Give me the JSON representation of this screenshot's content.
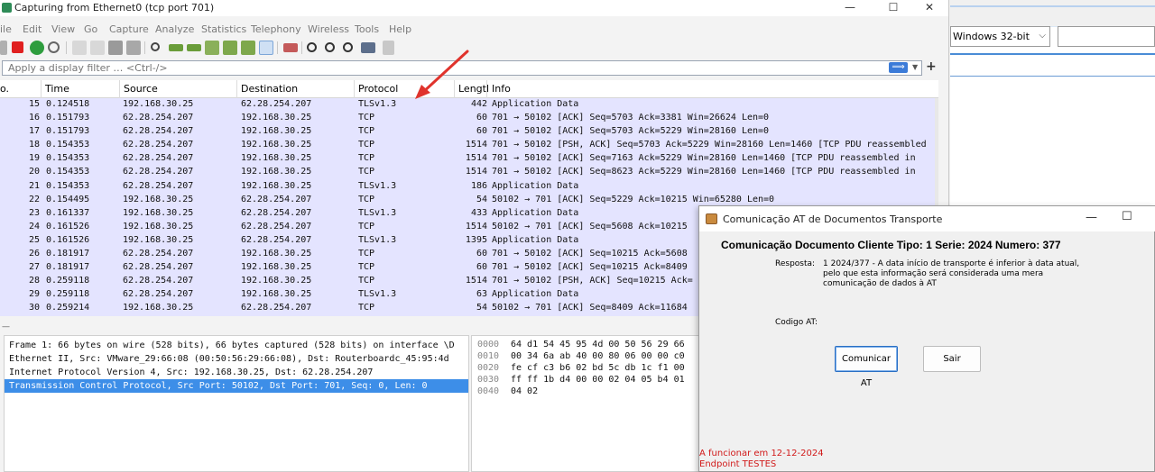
{
  "wireshark": {
    "title": "Capturing from Ethernet0 (tcp port 701)",
    "menu": [
      "ile",
      "Edit",
      "View",
      "Go",
      "Capture",
      "Analyze",
      "Statistics",
      "Telephony",
      "Wireless",
      "Tools",
      "Help"
    ],
    "filter_placeholder": "Apply a display filter … <Ctrl-/>",
    "columns": [
      "o.",
      "Time",
      "Source",
      "Destination",
      "Protocol",
      "Lengtl",
      "Info"
    ],
    "packets": [
      {
        "no": "15",
        "time": "0.124518",
        "src": "192.168.30.25",
        "dst": "62.28.254.207",
        "proto": "TLSv1.3",
        "len": "442",
        "info": "Application Data"
      },
      {
        "no": "16",
        "time": "0.151793",
        "src": "62.28.254.207",
        "dst": "192.168.30.25",
        "proto": "TCP",
        "len": "60",
        "info": "701 → 50102 [ACK] Seq=5703 Ack=3381 Win=26624 Len=0"
      },
      {
        "no": "17",
        "time": "0.151793",
        "src": "62.28.254.207",
        "dst": "192.168.30.25",
        "proto": "TCP",
        "len": "60",
        "info": "701 → 50102 [ACK] Seq=5703 Ack=5229 Win=28160 Len=0"
      },
      {
        "no": "18",
        "time": "0.154353",
        "src": "62.28.254.207",
        "dst": "192.168.30.25",
        "proto": "TCP",
        "len": "1514",
        "info": "701 → 50102 [PSH, ACK] Seq=5703 Ack=5229 Win=28160 Len=1460 [TCP PDU reassembled"
      },
      {
        "no": "19",
        "time": "0.154353",
        "src": "62.28.254.207",
        "dst": "192.168.30.25",
        "proto": "TCP",
        "len": "1514",
        "info": "701 → 50102 [ACK] Seq=7163 Ack=5229 Win=28160 Len=1460 [TCP PDU reassembled in"
      },
      {
        "no": "20",
        "time": "0.154353",
        "src": "62.28.254.207",
        "dst": "192.168.30.25",
        "proto": "TCP",
        "len": "1514",
        "info": "701 → 50102 [ACK] Seq=8623 Ack=5229 Win=28160 Len=1460 [TCP PDU reassembled in"
      },
      {
        "no": "21",
        "time": "0.154353",
        "src": "62.28.254.207",
        "dst": "192.168.30.25",
        "proto": "TLSv1.3",
        "len": "186",
        "info": "Application Data"
      },
      {
        "no": "22",
        "time": "0.154495",
        "src": "192.168.30.25",
        "dst": "62.28.254.207",
        "proto": "TCP",
        "len": "54",
        "info": "50102 → 701 [ACK] Seq=5229 Ack=10215 Win=65280 Len=0"
      },
      {
        "no": "23",
        "time": "0.161337",
        "src": "192.168.30.25",
        "dst": "62.28.254.207",
        "proto": "TLSv1.3",
        "len": "433",
        "info": "Application Data"
      },
      {
        "no": "24",
        "time": "0.161526",
        "src": "192.168.30.25",
        "dst": "62.28.254.207",
        "proto": "TCP",
        "len": "1514",
        "info": "50102 → 701 [ACK] Seq=5608 Ack=10215"
      },
      {
        "no": "25",
        "time": "0.161526",
        "src": "192.168.30.25",
        "dst": "62.28.254.207",
        "proto": "TLSv1.3",
        "len": "1395",
        "info": "Application Data"
      },
      {
        "no": "26",
        "time": "0.181917",
        "src": "62.28.254.207",
        "dst": "192.168.30.25",
        "proto": "TCP",
        "len": "60",
        "info": "701 → 50102 [ACK] Seq=10215 Ack=5608"
      },
      {
        "no": "27",
        "time": "0.181917",
        "src": "62.28.254.207",
        "dst": "192.168.30.25",
        "proto": "TCP",
        "len": "60",
        "info": "701 → 50102 [ACK] Seq=10215 Ack=8409"
      },
      {
        "no": "28",
        "time": "0.259118",
        "src": "62.28.254.207",
        "dst": "192.168.30.25",
        "proto": "TCP",
        "len": "1514",
        "info": "701 → 50102 [PSH, ACK] Seq=10215 Ack="
      },
      {
        "no": "29",
        "time": "0.259118",
        "src": "62.28.254.207",
        "dst": "192.168.30.25",
        "proto": "TLSv1.3",
        "len": "63",
        "info": "Application Data"
      },
      {
        "no": "30",
        "time": "0.259214",
        "src": "192.168.30.25",
        "dst": "62.28.254.207",
        "proto": "TCP",
        "len": "54",
        "info": "50102 → 701 [ACK] Seq=8409 Ack=11684"
      }
    ],
    "details": [
      "Frame 1: 66 bytes on wire (528 bits), 66 bytes captured (528 bits) on interface \\D",
      "Ethernet II, Src: VMware_29:66:08 (00:50:56:29:66:08), Dst: Routerboardc_45:95:4d",
      "Internet Protocol Version 4, Src: 192.168.30.25, Dst: 62.28.254.207",
      "Transmission Control Protocol, Src Port: 50102, Dst Port: 701, Seq: 0, Len: 0"
    ],
    "bytes": [
      {
        "offset": "0000",
        "hex": "64 d1 54 45 95 4d 00 50  56 29 66"
      },
      {
        "offset": "0010",
        "hex": "00 34 6a ab 40 00 80 06  00 00 c0"
      },
      {
        "offset": "0020",
        "hex": "fe cf c3 b6 02 bd 5c db  1c f1 00"
      },
      {
        "offset": "0030",
        "hex": "ff ff 1b d4 00 00 02 04  05 b4 01"
      },
      {
        "offset": "0040",
        "hex": "04 02"
      }
    ]
  },
  "background_window": {
    "os_select": "Windows 32-bit"
  },
  "dialog": {
    "title": "Comunicação AT de Documentos Transporte",
    "heading": "Comunicação Documento Cliente Tipo: 1 Serie: 2024 Numero: 377",
    "resposta_label": "Resposta:",
    "resposta_text": "1 2024/377 - A data início de transporte é inferior à data atual, pelo que esta informação será considerada uma mera comunicação de dados à AT",
    "codigo_label": "Codigo AT:",
    "btn_comunicar": "Comunicar AT",
    "btn_sair": "Sair",
    "status_line1": "A funcionar em 12-12-2024",
    "status_line2": "Endpoint TESTES"
  },
  "colors": {
    "row_bg": "#e4e4ff",
    "selected_detail": "#3d8ee8",
    "status_red": "#d11a1a",
    "arrow_red": "#e0332c"
  }
}
